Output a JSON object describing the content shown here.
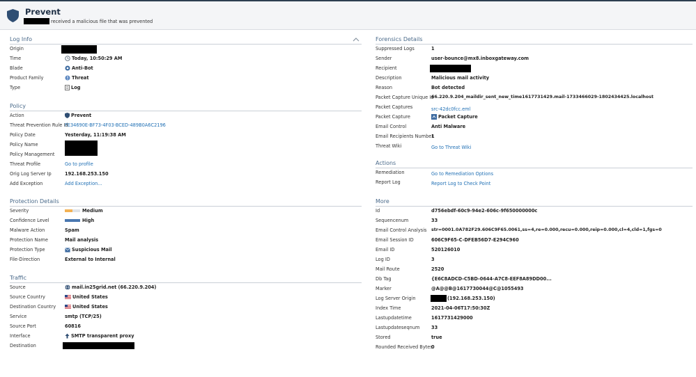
{
  "header": {
    "title": "Prevent",
    "subtitle": "received a malicious file that was prevented"
  },
  "colors": {
    "header_bg": "#f4f5f7",
    "section_title": "#4a6a8a",
    "link": "#1f6fb4",
    "shield": "#2f4e73",
    "severity_bar": "#f3b255",
    "confidence_bar": "#4a78b0"
  },
  "log_info": {
    "title": "Log Info",
    "rows": [
      {
        "label": "Origin",
        "value": ""
      },
      {
        "label": "Time",
        "value": "Today, 10:50:29 AM",
        "icon": "clock-icon"
      },
      {
        "label": "Blade",
        "value": "Anti-Bot",
        "icon": "anti-bot-icon"
      },
      {
        "label": "Product Family",
        "value": "Threat",
        "icon": "threat-icon"
      },
      {
        "label": "Type",
        "value": "Log",
        "icon": "log-icon"
      }
    ]
  },
  "policy": {
    "title": "Policy",
    "rows": [
      {
        "label": "Action",
        "value": "Prevent",
        "icon": "shield-icon"
      },
      {
        "label": "Threat Prevention Rule Id",
        "value": "FE34690E-BF73-4F03-BCED-489B0A6C2196"
      },
      {
        "label": "Policy Date",
        "value": "Yesterday, 11:19:38 AM"
      },
      {
        "label": "Policy Name",
        "value": ""
      },
      {
        "label": "Policy Management",
        "value": ""
      },
      {
        "label": "Threat Profile",
        "value": "Go to profile"
      },
      {
        "label": "Orig Log Server Ip",
        "value": "192.168.253.150"
      },
      {
        "label": "Add Exception",
        "value": "Add Exception..."
      }
    ]
  },
  "protection_details": {
    "title": "Protection Details",
    "rows": [
      {
        "label": "Severity",
        "value": "Medium",
        "level": 0.5
      },
      {
        "label": "Confidence Level",
        "value": "High",
        "level": 1.0
      },
      {
        "label": "Malware Action",
        "value": "Spam"
      },
      {
        "label": "Protection Name",
        "value": "Mail analysis"
      },
      {
        "label": "Protection Type",
        "value": "Suspicious Mail",
        "icon": "mail-icon"
      },
      {
        "label": "File-Direction",
        "value": "External to Internal"
      }
    ]
  },
  "traffic": {
    "title": "Traffic",
    "rows": [
      {
        "label": "Source",
        "value": "mail.in25grid.net (66.220.9.204)",
        "icon": "globe-icon"
      },
      {
        "label": "Source Country",
        "value": "United States",
        "icon": "us-flag-icon"
      },
      {
        "label": "Destination Country",
        "value": "United States",
        "icon": "us-flag-icon"
      },
      {
        "label": "Service",
        "value": "smtp (TCP/25)"
      },
      {
        "label": "Source Port",
        "value": "60816"
      },
      {
        "label": "Interface",
        "value": "SMTP transparent proxy",
        "icon": "arrow-up-icon"
      },
      {
        "label": "Destination",
        "value": ""
      }
    ]
  },
  "forensics": {
    "title": "Forensics Details",
    "rows": [
      {
        "label": "Suppressed Logs",
        "value": "1"
      },
      {
        "label": "Sender",
        "value": "user-bounce@mx8.inboxgateway.com"
      },
      {
        "label": "Recipient",
        "value": ""
      },
      {
        "label": "Description",
        "value": "Malicious mail activity"
      },
      {
        "label": "Reason",
        "value": "Bot detected"
      },
      {
        "label": "Packet Capture Unique Id",
        "value": "66.220.9.204_maildir_sent_new_time1617731429.mail-1733466029-1802434425.localhost"
      },
      {
        "label": "Packet Captures",
        "value": "src-42dc0fcc.eml"
      },
      {
        "label": "Packet Capture",
        "value": "Packet Capture",
        "icon": "packet-capture-icon"
      },
      {
        "label": "Email Control",
        "value": "Anti Malware"
      },
      {
        "label": "Email Recipients Number",
        "value": "1"
      },
      {
        "label": "Threat Wiki",
        "value": "Go to Threat Wiki"
      }
    ]
  },
  "actions": {
    "title": "Actions",
    "rows": [
      {
        "label": "Remediation",
        "value": "Go to Remediation Options"
      },
      {
        "label": "Report Log",
        "value": "Report Log to Check Point"
      }
    ]
  },
  "more": {
    "title": "More",
    "rows": [
      {
        "label": "Id",
        "value": "d756ebdf-60c9-94e2-606c-9f650000000c"
      },
      {
        "label": "Sequencenum",
        "value": "33"
      },
      {
        "label": "Email Control Analysis",
        "value": "str=0001.0A782F29.606C9F65.0061,ss=4,re=0.000,recu=0.000,reip=0.000,cl=4,cld=1,fgs=0"
      },
      {
        "label": "Email Session ID",
        "value": "606C9F65-C-DFEB56D7-E294C960"
      },
      {
        "label": "Email ID",
        "value": "520126010"
      },
      {
        "label": "Log ID",
        "value": "3"
      },
      {
        "label": "Mail Route",
        "value": "2520"
      },
      {
        "label": "Db Tag",
        "value": "{E6C8ADCD-C5BD-0644-A7C8-EEF8A89DD00..."
      },
      {
        "label": "Marker",
        "value": "@A@@B@1617730044@C@1055493"
      },
      {
        "label": "Log Server Origin",
        "value": "(192.168.253.150)"
      },
      {
        "label": "Index Time",
        "value": "2021-04-06T17:50:30Z"
      },
      {
        "label": "Lastupdatetime",
        "value": "1617731429000"
      },
      {
        "label": "Lastupdateseqnum",
        "value": "33"
      },
      {
        "label": "Stored",
        "value": "true"
      },
      {
        "label": "Rounded Received Bytes",
        "value": "0"
      }
    ]
  }
}
